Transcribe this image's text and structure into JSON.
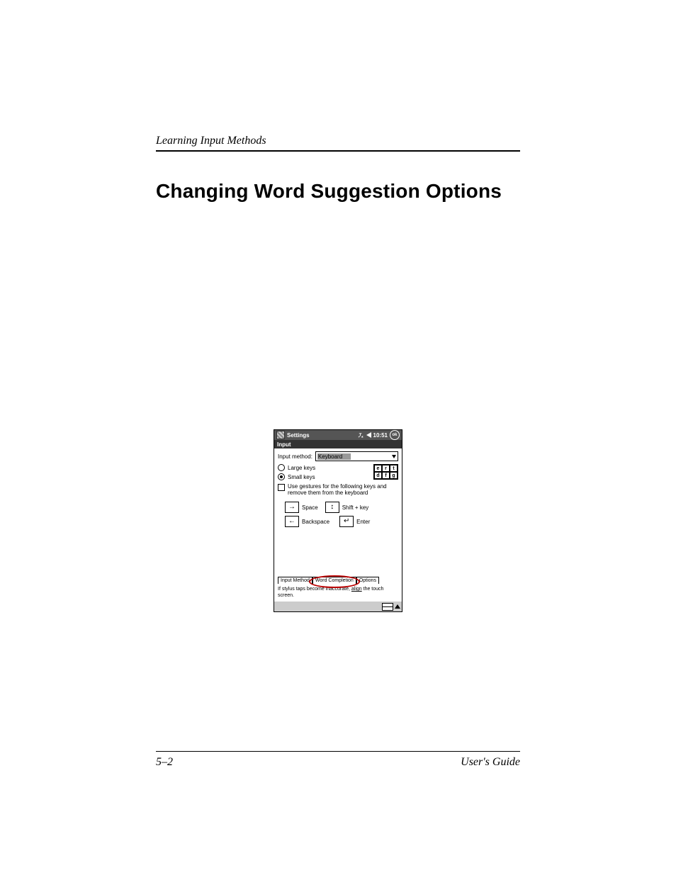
{
  "page": {
    "section_label": "Learning Input Methods",
    "heading": "Changing Word Suggestion Options",
    "page_number": "5–2",
    "footer_right": "User's Guide"
  },
  "ppc": {
    "titlebar": {
      "label": "Settings",
      "time": "10:51",
      "ok": "ok"
    },
    "subtitle": "Input",
    "input_method": {
      "label": "Input method:",
      "value": "Keyboard"
    },
    "keysize": {
      "large": "Large keys",
      "small": "Small keys",
      "selected": "small",
      "sample": [
        "e",
        "r",
        "t",
        "d",
        "f",
        "g"
      ]
    },
    "gesture_checkbox": "Use gestures for the following keys and remove them from the keyboard",
    "gestures": {
      "space": "Space",
      "shift": "Shift + key",
      "backspace": "Backspace",
      "enter": "Enter"
    },
    "tabs": {
      "t1": "Input Method",
      "t2": "Word Completion",
      "t3": "Options"
    },
    "hint_a": "If stylus taps become inaccurate, ",
    "hint_link": "align",
    "hint_b": " the touch screen."
  }
}
